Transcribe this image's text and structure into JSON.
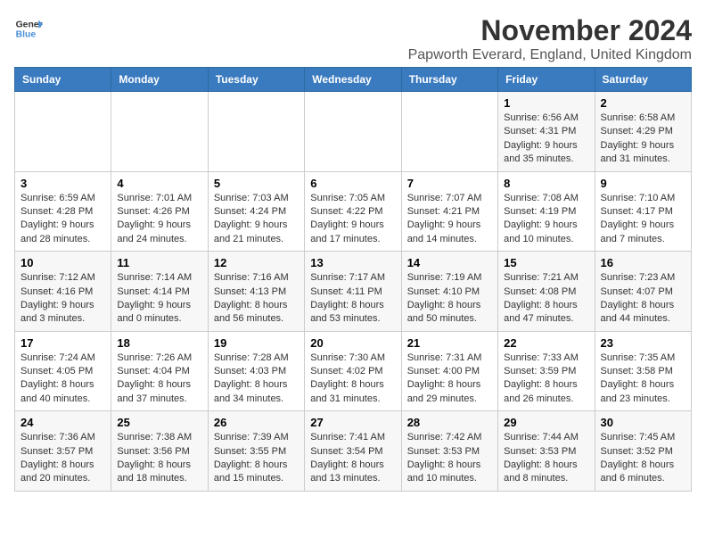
{
  "logo": {
    "line1": "General",
    "line2": "Blue"
  },
  "title": "November 2024",
  "location": "Papworth Everard, England, United Kingdom",
  "days_of_week": [
    "Sunday",
    "Monday",
    "Tuesday",
    "Wednesday",
    "Thursday",
    "Friday",
    "Saturday"
  ],
  "weeks": [
    [
      {
        "day": "",
        "info": ""
      },
      {
        "day": "",
        "info": ""
      },
      {
        "day": "",
        "info": ""
      },
      {
        "day": "",
        "info": ""
      },
      {
        "day": "",
        "info": ""
      },
      {
        "day": "1",
        "info": "Sunrise: 6:56 AM\nSunset: 4:31 PM\nDaylight: 9 hours and 35 minutes."
      },
      {
        "day": "2",
        "info": "Sunrise: 6:58 AM\nSunset: 4:29 PM\nDaylight: 9 hours and 31 minutes."
      }
    ],
    [
      {
        "day": "3",
        "info": "Sunrise: 6:59 AM\nSunset: 4:28 PM\nDaylight: 9 hours and 28 minutes."
      },
      {
        "day": "4",
        "info": "Sunrise: 7:01 AM\nSunset: 4:26 PM\nDaylight: 9 hours and 24 minutes."
      },
      {
        "day": "5",
        "info": "Sunrise: 7:03 AM\nSunset: 4:24 PM\nDaylight: 9 hours and 21 minutes."
      },
      {
        "day": "6",
        "info": "Sunrise: 7:05 AM\nSunset: 4:22 PM\nDaylight: 9 hours and 17 minutes."
      },
      {
        "day": "7",
        "info": "Sunrise: 7:07 AM\nSunset: 4:21 PM\nDaylight: 9 hours and 14 minutes."
      },
      {
        "day": "8",
        "info": "Sunrise: 7:08 AM\nSunset: 4:19 PM\nDaylight: 9 hours and 10 minutes."
      },
      {
        "day": "9",
        "info": "Sunrise: 7:10 AM\nSunset: 4:17 PM\nDaylight: 9 hours and 7 minutes."
      }
    ],
    [
      {
        "day": "10",
        "info": "Sunrise: 7:12 AM\nSunset: 4:16 PM\nDaylight: 9 hours and 3 minutes."
      },
      {
        "day": "11",
        "info": "Sunrise: 7:14 AM\nSunset: 4:14 PM\nDaylight: 9 hours and 0 minutes."
      },
      {
        "day": "12",
        "info": "Sunrise: 7:16 AM\nSunset: 4:13 PM\nDaylight: 8 hours and 56 minutes."
      },
      {
        "day": "13",
        "info": "Sunrise: 7:17 AM\nSunset: 4:11 PM\nDaylight: 8 hours and 53 minutes."
      },
      {
        "day": "14",
        "info": "Sunrise: 7:19 AM\nSunset: 4:10 PM\nDaylight: 8 hours and 50 minutes."
      },
      {
        "day": "15",
        "info": "Sunrise: 7:21 AM\nSunset: 4:08 PM\nDaylight: 8 hours and 47 minutes."
      },
      {
        "day": "16",
        "info": "Sunrise: 7:23 AM\nSunset: 4:07 PM\nDaylight: 8 hours and 44 minutes."
      }
    ],
    [
      {
        "day": "17",
        "info": "Sunrise: 7:24 AM\nSunset: 4:05 PM\nDaylight: 8 hours and 40 minutes."
      },
      {
        "day": "18",
        "info": "Sunrise: 7:26 AM\nSunset: 4:04 PM\nDaylight: 8 hours and 37 minutes."
      },
      {
        "day": "19",
        "info": "Sunrise: 7:28 AM\nSunset: 4:03 PM\nDaylight: 8 hours and 34 minutes."
      },
      {
        "day": "20",
        "info": "Sunrise: 7:30 AM\nSunset: 4:02 PM\nDaylight: 8 hours and 31 minutes."
      },
      {
        "day": "21",
        "info": "Sunrise: 7:31 AM\nSunset: 4:00 PM\nDaylight: 8 hours and 29 minutes."
      },
      {
        "day": "22",
        "info": "Sunrise: 7:33 AM\nSunset: 3:59 PM\nDaylight: 8 hours and 26 minutes."
      },
      {
        "day": "23",
        "info": "Sunrise: 7:35 AM\nSunset: 3:58 PM\nDaylight: 8 hours and 23 minutes."
      }
    ],
    [
      {
        "day": "24",
        "info": "Sunrise: 7:36 AM\nSunset: 3:57 PM\nDaylight: 8 hours and 20 minutes."
      },
      {
        "day": "25",
        "info": "Sunrise: 7:38 AM\nSunset: 3:56 PM\nDaylight: 8 hours and 18 minutes."
      },
      {
        "day": "26",
        "info": "Sunrise: 7:39 AM\nSunset: 3:55 PM\nDaylight: 8 hours and 15 minutes."
      },
      {
        "day": "27",
        "info": "Sunrise: 7:41 AM\nSunset: 3:54 PM\nDaylight: 8 hours and 13 minutes."
      },
      {
        "day": "28",
        "info": "Sunrise: 7:42 AM\nSunset: 3:53 PM\nDaylight: 8 hours and 10 minutes."
      },
      {
        "day": "29",
        "info": "Sunrise: 7:44 AM\nSunset: 3:53 PM\nDaylight: 8 hours and 8 minutes."
      },
      {
        "day": "30",
        "info": "Sunrise: 7:45 AM\nSunset: 3:52 PM\nDaylight: 8 hours and 6 minutes."
      }
    ]
  ]
}
